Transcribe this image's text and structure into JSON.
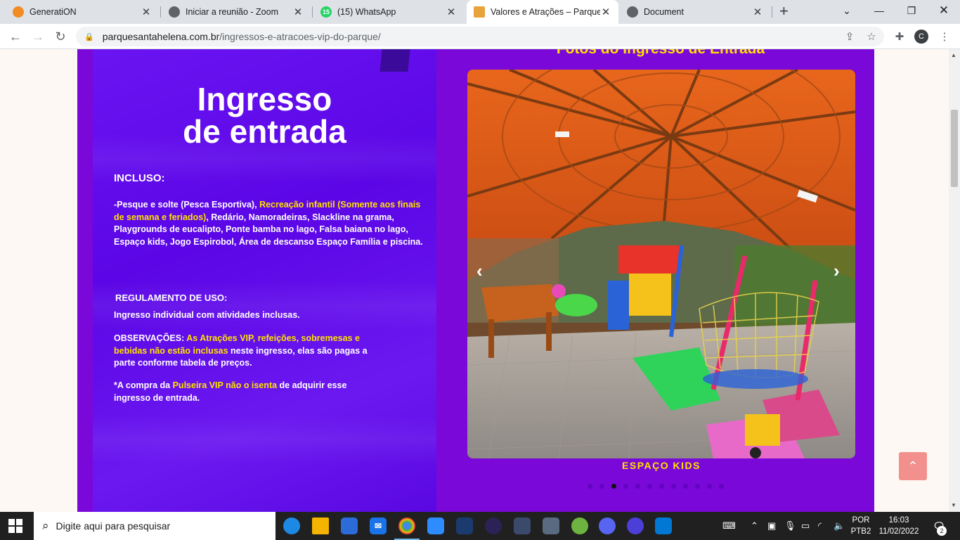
{
  "browser": {
    "tabs": [
      {
        "title": "GeneratiON",
        "favicon_color": "#f28b22",
        "active": false
      },
      {
        "title": "Iniciar a reunião - Zoom",
        "favicon_color": "#5f6368",
        "active": false
      },
      {
        "title": "(15) WhatsApp",
        "favicon_color": "#25d366",
        "favicon_text": "15",
        "active": false
      },
      {
        "title": "Valores e Atrações – Parque S",
        "favicon_color": "#e8a33c",
        "active": true
      },
      {
        "title": "Document",
        "favicon_color": "#5f6368",
        "active": false
      }
    ],
    "address": {
      "domain": "parquesantahelena.com.br",
      "path": "/ingressos-e-atracoes-vip-do-parque/"
    },
    "profile_initial": "C"
  },
  "page": {
    "poster": {
      "title_line1": "Ingresso",
      "title_line2": "de entrada",
      "included_heading": "INCLUSO:",
      "included_p1": "-Pesque e solte ",
      "included_p2": "(Pesca Esportiva)",
      "included_p3": ", ",
      "included_p4": "Recreação infantil",
      "included_p5": "(Somente aos finais de semana e feriados)",
      "included_p6": ", Redário, Namoradeiras, Slackline na grama, Playgrounds de eucalipto, Ponte bamba no lago, Falsa baiana no lago, Espaço kids, Jogo Espirobol, Área de descanso Espaço Família e piscina.",
      "rules_heading": "REGULAMENTO DE USO:",
      "rules_text": "Ingresso individual com atividades inclusas.",
      "obs_label": "OBSERVAÇÕES: ",
      "obs_highlight": "As Atrações VIP, refeições, sobremesas e bebidas não estão inclusas",
      "obs_rest": " neste ingresso, elas são pagas a parte conforme tabela de preços.",
      "note_p1": "*A compra da ",
      "note_p2": "Pulseira VIP",
      "note_p3": " ",
      "note_p4": "não o isenta",
      "note_p5": " de adquirir esse ingresso de entrada."
    },
    "photos_title": "Fotos do Ingresso de Entrada",
    "carousel": {
      "caption": "ESPAÇO KIDS",
      "slide_count": 12,
      "active_index": 2,
      "prev_icon": "chevron-left-icon",
      "next_icon": "chevron-right-icon"
    },
    "colors": {
      "section_bg": "#7a08d8",
      "accent_yellow": "#ffe000",
      "back_to_top": "#f1908c"
    }
  },
  "taskbar": {
    "search_placeholder": "Digite aqui para pesquisar",
    "language_line1": "POR",
    "language_line2": "PTB2",
    "time": "16:03",
    "date": "11/02/2022",
    "notification_count": "2"
  }
}
